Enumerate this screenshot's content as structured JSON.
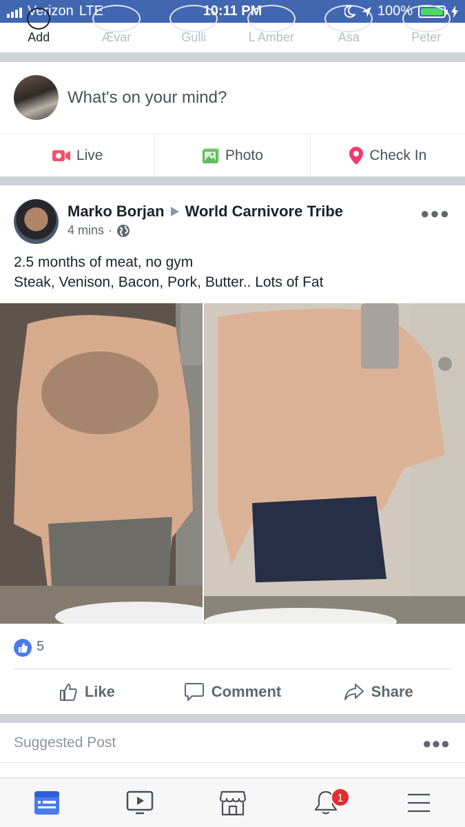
{
  "status_bar": {
    "carrier": "Verizon",
    "network": "LTE",
    "time": "10:11 PM",
    "battery": "100%",
    "battery_level": 1.0
  },
  "stories": [
    {
      "label": "Add"
    },
    {
      "label": "Ævar"
    },
    {
      "label": "Gulli"
    },
    {
      "label": "L Amber"
    },
    {
      "label": "Asa"
    },
    {
      "label": "Peter"
    }
  ],
  "composer": {
    "placeholder": "What's on your mind?",
    "actions": [
      {
        "label": "Live",
        "icon": "live-video-icon",
        "color": "#f25268"
      },
      {
        "label": "Photo",
        "icon": "photo-icon",
        "color": "#5fbb60"
      },
      {
        "label": "Check In",
        "icon": "location-pin-icon",
        "color": "#f23a6c"
      }
    ]
  },
  "post": {
    "author": "Marko Borjan",
    "group": "World Carnivore Tribe",
    "time": "4 mins",
    "audience_icon": "globe-icon",
    "text_line1": "2.5 months of meat, no gym",
    "text_line2": "Steak, Venison, Bacon, Pork, Butter.. Lots of Fat",
    "likes": "5",
    "actions": {
      "like": "Like",
      "comment": "Comment",
      "share": "Share"
    }
  },
  "suggested": {
    "label": "Suggested Post"
  },
  "tabbar": {
    "active_color": "#4a7af0",
    "tabs": [
      "news-feed-icon",
      "watch-icon",
      "marketplace-icon",
      "notifications-icon",
      "menu-icon"
    ],
    "notification_count": "1"
  }
}
